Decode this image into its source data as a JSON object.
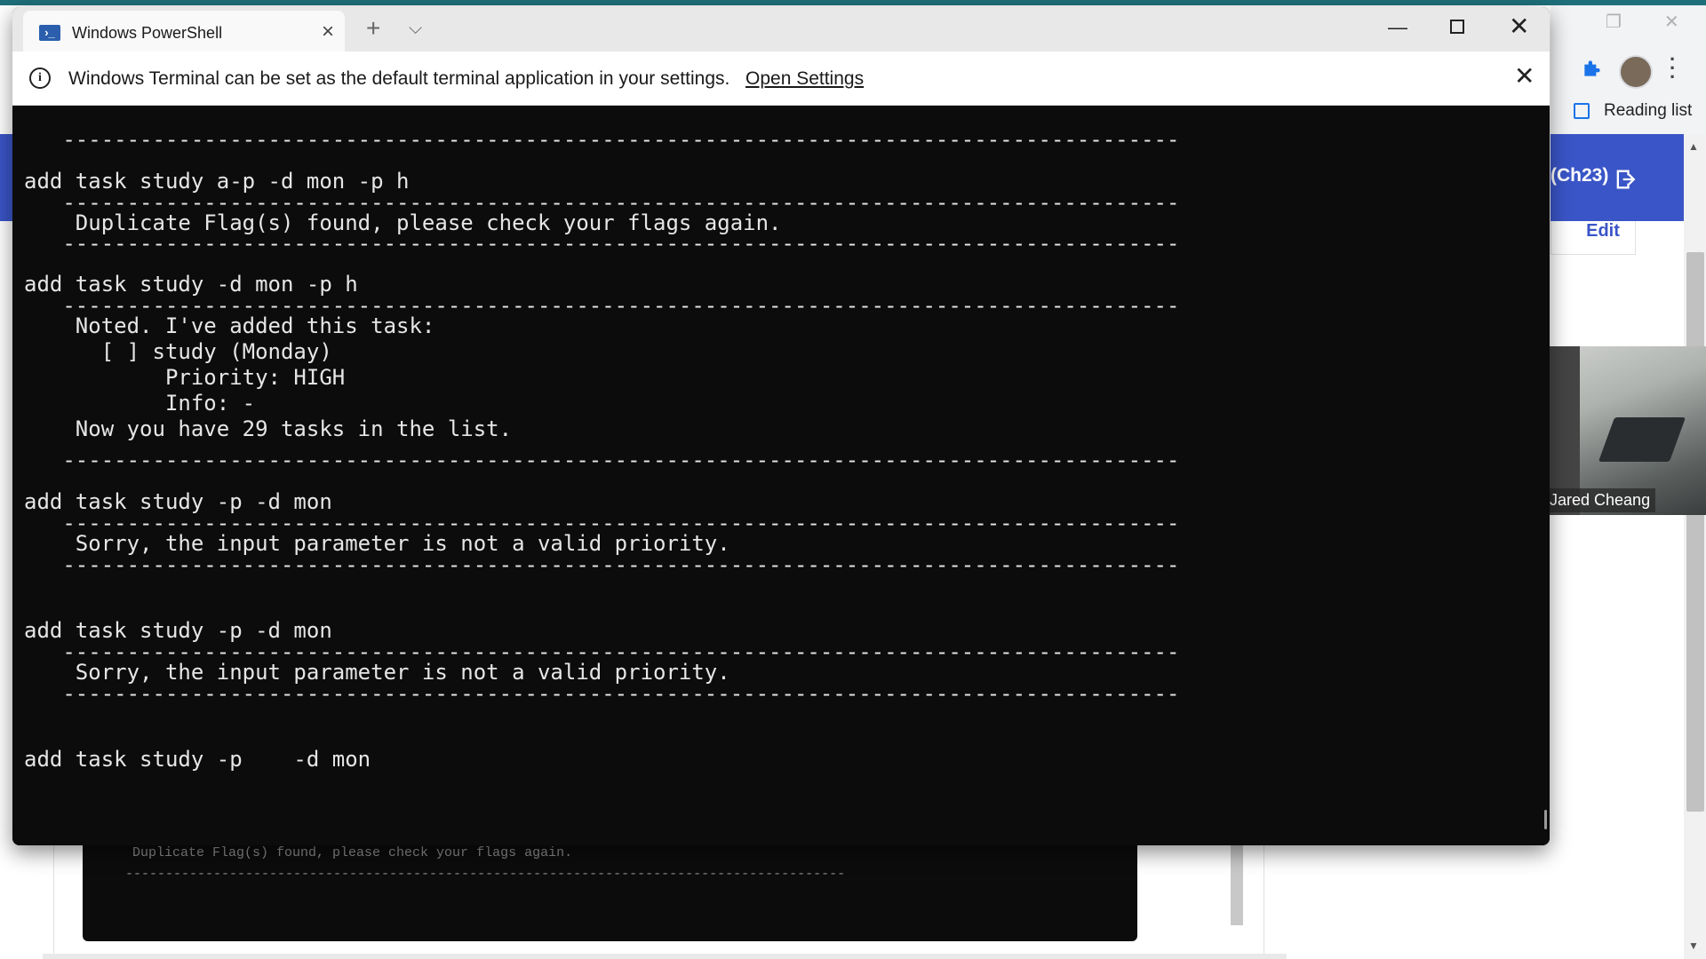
{
  "background": {
    "reading_list": "Reading list",
    "web_chip": "(Ch23)",
    "edit_label": "Edit",
    "participant_name": "Jared Cheang",
    "bg_terminal_line1": "Duplicate Flag(s) found, please check your flags again.",
    "bg_terminal_line2": "------------------------------------------------------------------------------------------",
    "icons": [
      "restore-icon",
      "close-icon",
      "puzzle-icon",
      "avatar",
      "menu-icon",
      "reading-list-icon",
      "exit-icon"
    ]
  },
  "window": {
    "tab_title": "Windows PowerShell",
    "tab_icon": "powershell-icon",
    "new_tab": "+",
    "dropdown": "⌵",
    "minimize": "—",
    "close": "✕"
  },
  "infobar": {
    "message": "Windows Terminal can be set as the default terminal application in your settings.",
    "link": "Open Settings"
  },
  "terminal": {
    "lines": [
      "   ---------------------------------------------------------------------------------------",
      "add task study a-p -d mon -p h",
      "   ---------------------------------------------------------------------------------------",
      "    Duplicate Flag(s) found, please check your flags again.",
      "   ---------------------------------------------------------------------------------------",
      "add task study -d mon -p h",
      "   ---------------------------------------------------------------------------------------",
      "    Noted. I've added this task:",
      "      [ ] study (Monday)",
      "           Priority: HIGH",
      "           Info: -",
      "    Now you have 29 tasks in the list.",
      "   ---------------------------------------------------------------------------------------",
      "add task study -p -d mon",
      "   ---------------------------------------------------------------------------------------",
      "    Sorry, the input parameter is not a valid priority.",
      "   ---------------------------------------------------------------------------------------",
      "add task study -p -d mon",
      "   ---------------------------------------------------------------------------------------",
      "    Sorry, the input parameter is not a valid priority.",
      "   ---------------------------------------------------------------------------------------",
      "add task study -p    -d mon"
    ]
  }
}
